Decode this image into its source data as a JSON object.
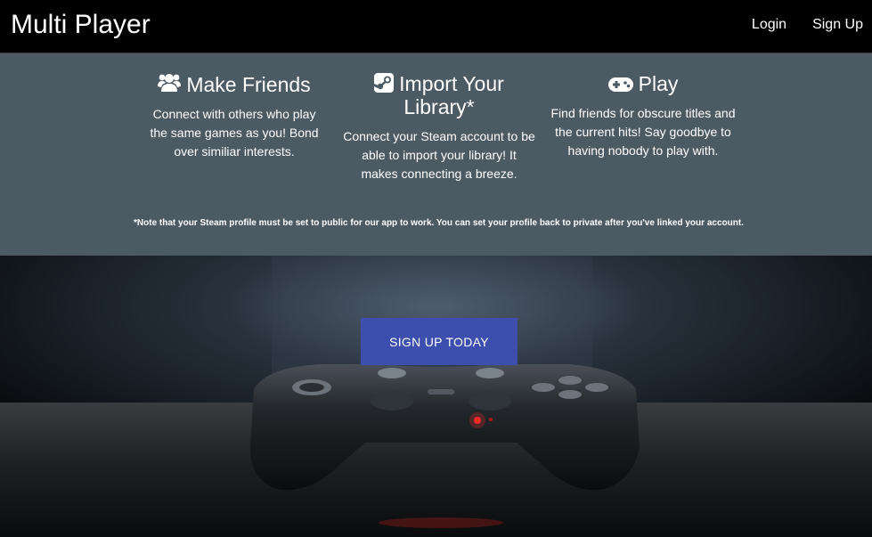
{
  "navbar": {
    "brand": "Multi Player",
    "links": [
      "Login",
      "Sign Up"
    ]
  },
  "features": [
    {
      "icon": "users-icon",
      "title": "Make Friends",
      "text": "Connect with others who play the same games as you! Bond over similiar interests."
    },
    {
      "icon": "steam-icon",
      "title": "Import Your Library*",
      "text": "Connect your Steam account to be able to import your library! It makes connecting a breeze."
    },
    {
      "icon": "gamepad-icon",
      "title": "Play",
      "text": "Find friends for obscure titles and the current hits! Say goodbye to having nobody to play with."
    }
  ],
  "note": "*Note that your Steam profile must be set to public for our app to work. You can set your profile back to private after you've linked your account.",
  "hero": {
    "cta_label": "SIGN UP TODAY",
    "image": "game-controller-photo"
  },
  "colors": {
    "navbar_bg": "#000000",
    "features_bg": "#4c5a63",
    "cta_bg": "#3c4fae"
  }
}
